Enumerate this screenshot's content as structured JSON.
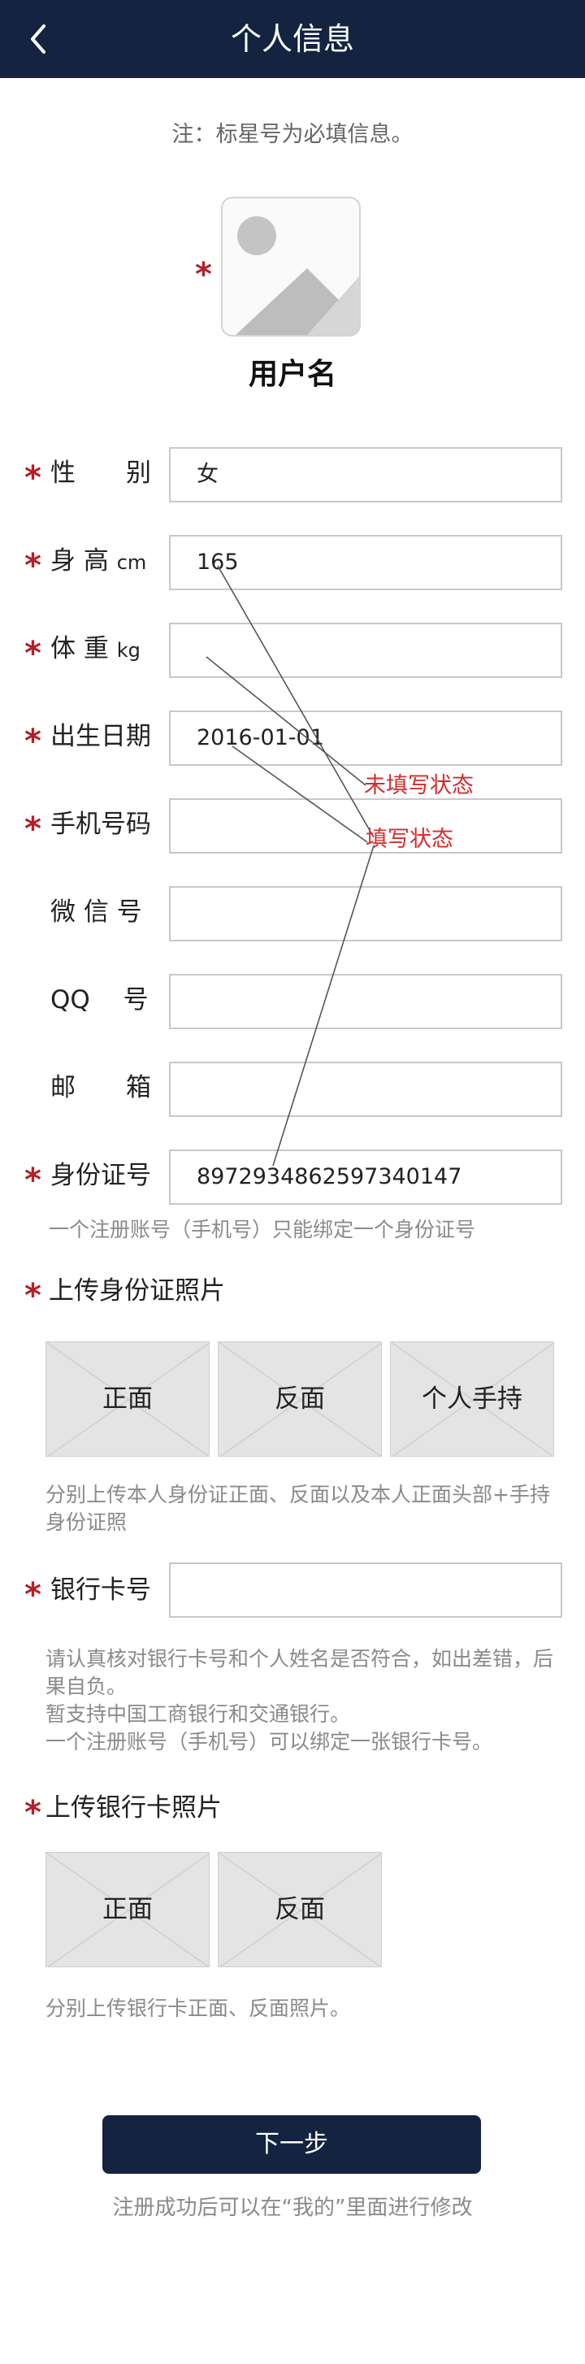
{
  "header": {
    "title": "个人信息"
  },
  "note": "注：标星号为必填信息。",
  "avatar": {
    "username": "用户名"
  },
  "required_mark": "*",
  "fields": {
    "gender": {
      "label": "性　　别",
      "value": "女"
    },
    "height": {
      "label": "身  高",
      "unit": "cm",
      "value": "165"
    },
    "weight": {
      "label": "体  重",
      "unit": "kg",
      "value": ""
    },
    "birthdate": {
      "label": "出生日期",
      "value": "2016-01-01"
    },
    "phone": {
      "label": "手机号码",
      "value": ""
    },
    "wechat": {
      "label": "微 信 号",
      "value": ""
    },
    "qq": {
      "label": "QQ　 号",
      "value": ""
    },
    "email": {
      "label": "邮　　箱",
      "value": ""
    },
    "id_number": {
      "label": "身份证号",
      "value": "897293486259734014​7"
    },
    "bank_card": {
      "label": "银行卡号",
      "value": ""
    }
  },
  "id_hint": "一个注册账号（手机号）只能绑定一个身份证号",
  "id_photos": {
    "title": "上传身份证照片",
    "items": [
      "正面",
      "反面",
      "个人手持"
    ],
    "hint": "分别上传本人身份证正面、反面以及本人正面头部+手持身份证照"
  },
  "bank_hints": [
    "请认真核对银行卡号和个人姓名是否符合，如出差错，后果自负。",
    "暂支持中国工商银行和交通银行。",
    "一个注册账号（手机号）可以绑定一张银行卡号。"
  ],
  "bank_photos": {
    "title": "上传银行卡照片",
    "items": [
      "正面",
      "反面"
    ],
    "hint": "分别上传银行卡正面、反面照片。"
  },
  "annotations": {
    "unfilled": "未填写状态",
    "filled": "填写状态"
  },
  "next_button": "下一步",
  "footer_note": "注册成功后可以在“我的”里面进行修改",
  "colors": {
    "header": "#132340",
    "required": "#b3202a",
    "annotation": "#d62c2c"
  }
}
